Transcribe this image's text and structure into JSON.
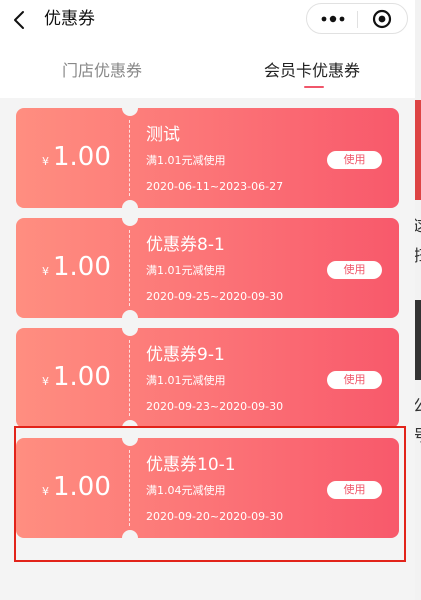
{
  "navbar": {
    "title": "优惠券"
  },
  "tabs": [
    {
      "label": "门店优惠券",
      "active": false
    },
    {
      "label": "会员卡优惠券",
      "active": true
    }
  ],
  "coupons": [
    {
      "currency": "¥",
      "amount": "1.00",
      "name": "测试",
      "condition": "满1.01元减使用",
      "date_range": "2020-06-11~2023-06-27",
      "button": "使用"
    },
    {
      "currency": "¥",
      "amount": "1.00",
      "name": "优惠券8-1",
      "condition": "满1.01元减使用",
      "date_range": "2020-09-25~2020-09-30",
      "button": "使用"
    },
    {
      "currency": "¥",
      "amount": "1.00",
      "name": "优惠券9-1",
      "condition": "满1.01元减使用",
      "date_range": "2020-09-23~2020-09-30",
      "button": "使用"
    },
    {
      "currency": "¥",
      "amount": "1.00",
      "name": "优惠券10-1",
      "condition": "满1.04元减使用",
      "date_range": "2020-09-20~2020-09-30",
      "button": "使用"
    }
  ],
  "colors": {
    "accent": "#f0566a",
    "coupon_gradient_start": "#ff8e80",
    "coupon_gradient_end": "#f8596b",
    "highlight_border": "#e2231a"
  },
  "icons": {
    "back": "chevron-left-icon",
    "more": "more-dots-icon",
    "close": "target-circle-icon"
  },
  "background_page": {
    "glyphs": [
      "这",
      "扫",
      "公",
      "号"
    ]
  }
}
